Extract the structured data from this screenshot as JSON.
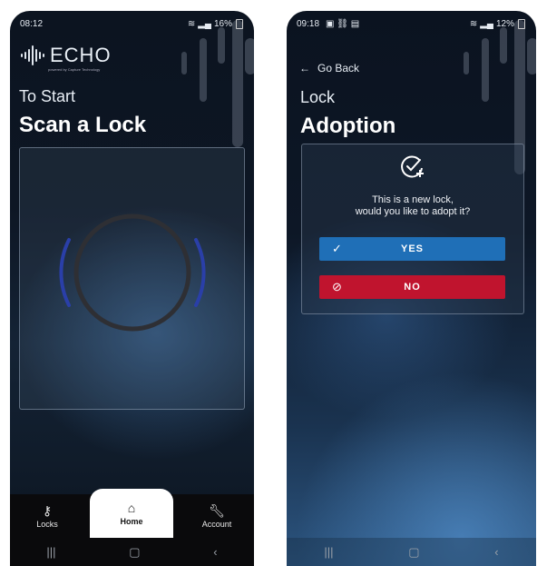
{
  "screen1": {
    "status": {
      "time": "08:12",
      "battery": "16%"
    },
    "logo": {
      "word": "ECHO",
      "tagline": "powered by Capture Technology"
    },
    "heading_small": "To Start",
    "heading_big": "Scan a Lock",
    "nav": {
      "locks": {
        "label": "Locks",
        "icon": "key-icon"
      },
      "home": {
        "label": "Home",
        "icon": "home-icon"
      },
      "account": {
        "label": "Account",
        "icon": "wrench-icon"
      }
    }
  },
  "screen2": {
    "status": {
      "time": "09:18",
      "battery": "12%"
    },
    "back_label": "Go Back",
    "heading_small": "Lock",
    "heading_big": "Adoption",
    "card": {
      "line1": "This is a new lock,",
      "line2": "would you like to adopt it?",
      "yes_label": "YES",
      "no_label": "NO"
    }
  },
  "colors": {
    "yes": "#1f6fb7",
    "no": "#c0142e",
    "scan_ring": "#2a3fa8"
  }
}
